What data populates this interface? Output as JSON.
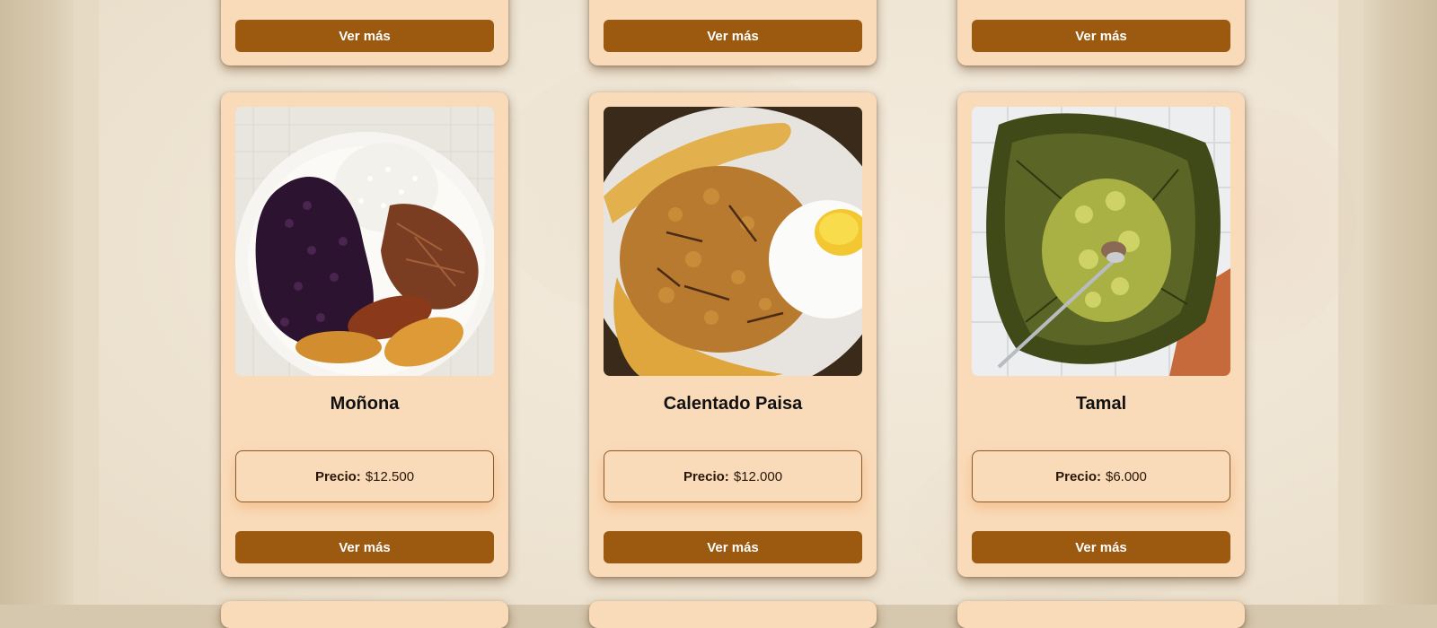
{
  "catalog": {
    "button_label": "Ver más",
    "price_label": "Precio:",
    "top_row": [
      {
        "button": "Ver más"
      },
      {
        "button": "Ver más"
      },
      {
        "button": "Ver más"
      }
    ],
    "products": [
      {
        "name": "Moñona",
        "price": "$12.500",
        "image": "plato-monona"
      },
      {
        "name": "Calentado Paisa",
        "price": "$12.000",
        "image": "plato-calentado-paisa"
      },
      {
        "name": "Tamal",
        "price": "$6.000",
        "image": "plato-tamal"
      }
    ]
  },
  "colors": {
    "card_bg": "#f9dbba",
    "button_bg": "#9b5a0f",
    "page_bg": "#ede2cf"
  }
}
